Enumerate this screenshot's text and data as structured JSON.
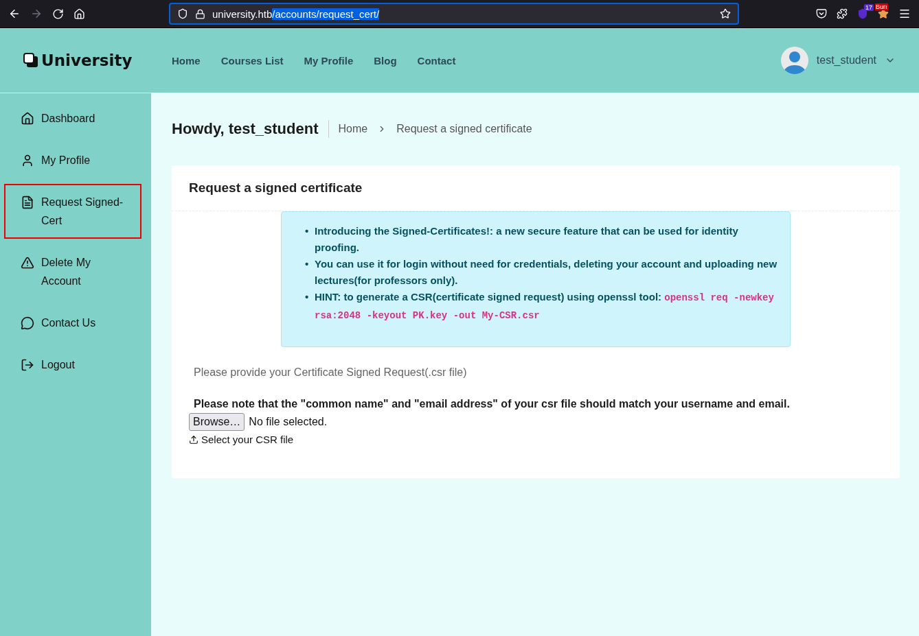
{
  "browser": {
    "url_host": "university.htb",
    "url_path": "/accounts/request_cert/",
    "extension_badge": "17",
    "burp_label": "Burı"
  },
  "site": {
    "logo": "University",
    "nav": [
      {
        "label": "Home"
      },
      {
        "label": "Courses List"
      },
      {
        "label": "My Profile"
      },
      {
        "label": "Blog"
      },
      {
        "label": "Contact"
      }
    ],
    "user": "test_student"
  },
  "sidebar": {
    "items": [
      {
        "label": "Dashboard",
        "selected": false
      },
      {
        "label": "My Profile",
        "selected": false
      },
      {
        "label": "Request Signed-Cert",
        "selected": true
      },
      {
        "label": "Delete My Account",
        "selected": false
      },
      {
        "label": "Contact Us",
        "selected": false
      },
      {
        "label": "Logout",
        "selected": false
      }
    ]
  },
  "page": {
    "greeting": "Howdy, test_student",
    "breadcrumb": [
      "Home",
      "Request a signed certificate"
    ]
  },
  "card": {
    "title": "Request a signed certificate",
    "notes": [
      {
        "bullet": "•",
        "text": "Introducing the Signed-Certificates!: a new secure feature that can be used for identity proofing."
      },
      {
        "bullet": "•",
        "text": "You can use it for login without need for credentials, deleting your account and uploading new lectures(for professors only)."
      },
      {
        "bullet": "•",
        "text": "HINT: to generate a CSR(certificate signed request) using openssl tool: ",
        "code": "openssl req -newkey rsa:2048 -keyout PK.key -out My-CSR.csr"
      }
    ],
    "prompt": "Please provide your Certificate Signed Request(.csr file)",
    "warning": "Please note that the \"common name\" and \"email address\" of your csr file should match your username and email.",
    "browse_button": "Browse…",
    "file_status": "No file selected.",
    "upload_label": "Select your CSR file"
  }
}
